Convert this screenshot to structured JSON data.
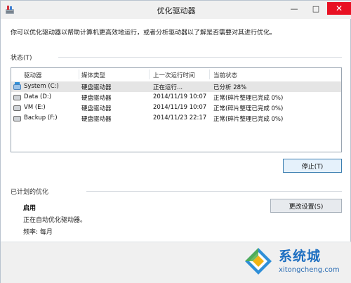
{
  "window": {
    "title": "优化驱动器"
  },
  "description": "你可以优化驱动器以帮助计算机更高效地运行，或者分析驱动器以了解是否需要对其进行优化。",
  "status_section": {
    "label": "状态(T)",
    "columns": [
      "驱动器",
      "媒体类型",
      "上一次运行时间",
      "当前状态"
    ],
    "rows": [
      {
        "drive": "System (C:)",
        "media": "硬盘驱动器",
        "last_run": "正在运行...",
        "status": "已分析 28%",
        "selected": true,
        "icon": "system-drive-icon"
      },
      {
        "drive": "Data (D:)",
        "media": "硬盘驱动器",
        "last_run": "2014/11/19 10:07",
        "status": "正常(碎片整理已完成 0%)",
        "icon": "hard-drive-icon"
      },
      {
        "drive": "VM (E:)",
        "media": "硬盘驱动器",
        "last_run": "2014/11/19 10:07",
        "status": "正常(碎片整理已完成 0%)",
        "icon": "hard-drive-icon"
      },
      {
        "drive": "Backup (F:)",
        "media": "硬盘驱动器",
        "last_run": "2014/11/23 22:17",
        "status": "正常(碎片整理已完成 0%)",
        "icon": "hard-drive-icon"
      }
    ],
    "stop_button": "停止(T)"
  },
  "schedule_section": {
    "label": "已计划的优化",
    "enabled_title": "启用",
    "enabled_desc": "正在自动优化驱动器。",
    "frequency": "频率: 每月",
    "change_button": "更改设置(S)"
  },
  "watermark": {
    "text": "系统城",
    "url": "xitongcheng.com"
  },
  "colors": {
    "accent": "#3c7fb1",
    "selection": "#e5e5e5",
    "close": "#e81123"
  }
}
